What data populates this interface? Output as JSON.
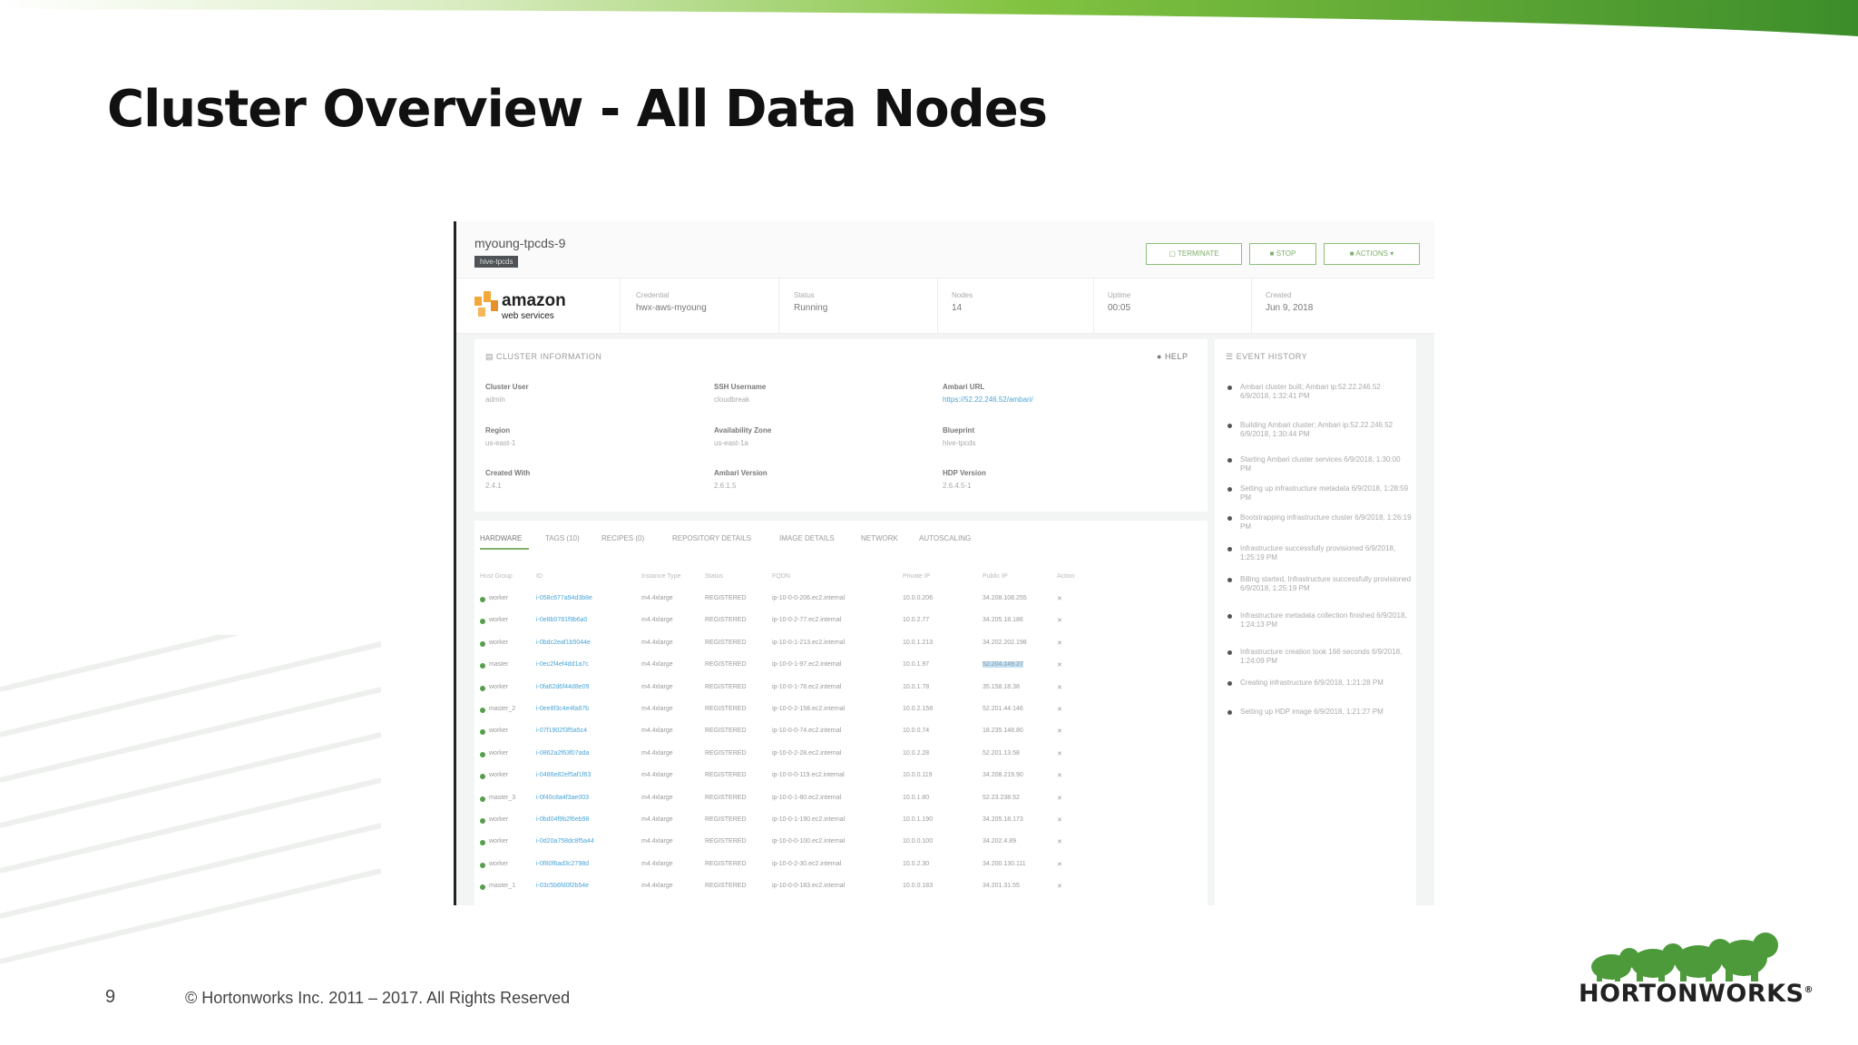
{
  "slide": {
    "title": "Cluster Overview - All Data Nodes",
    "page_number": "9",
    "copyright": "© Hortonworks Inc. 2011 – 2017. All Rights Reserved",
    "logo_text": "HORTONWORKS"
  },
  "colors": {
    "accent_green": "#6fb33f",
    "link_blue": "#4aa5d8"
  },
  "screenshot": {
    "cluster_name": "myoung-tpcds-9",
    "cluster_tag": "hive-tpcds",
    "buttons": {
      "terminate": "TERMINATE",
      "stop": "STOP",
      "actions": "ACTIONS"
    },
    "provider": {
      "line1": "amazon",
      "line2": "web services"
    },
    "summary": [
      {
        "label": "Credential",
        "value": "hwx-aws-myoung"
      },
      {
        "label": "Status",
        "value": "Running"
      },
      {
        "label": "Nodes",
        "value": "14"
      },
      {
        "label": "Uptime",
        "value": "00:05"
      },
      {
        "label": "Created",
        "value": "Jun 9, 2018"
      }
    ],
    "cluster_info": {
      "title": "CLUSTER INFORMATION",
      "help": "HELP",
      "fields": [
        {
          "label": "Cluster User",
          "value": "admin"
        },
        {
          "label": "SSH Username",
          "value": "cloudbreak"
        },
        {
          "label": "Ambari URL",
          "value": "https://52.22.246.52/ambari/"
        },
        {
          "label": "Region",
          "value": "us-east-1"
        },
        {
          "label": "Availability Zone",
          "value": "us-east-1a"
        },
        {
          "label": "Blueprint",
          "value": "hive-tpcds"
        },
        {
          "label": "Created With",
          "value": "2.4.1"
        },
        {
          "label": "Ambari Version",
          "value": "2.6.1.5"
        },
        {
          "label": "HDP Version",
          "value": "2.6.4.5-1"
        }
      ]
    },
    "tabs": [
      "HARDWARE",
      "TAGS (10)",
      "RECIPES (0)",
      "REPOSITORY DETAILS",
      "IMAGE DETAILS",
      "NETWORK",
      "AUTOSCALING"
    ],
    "table": {
      "headers": [
        "Host Group",
        "ID",
        "Instance Type",
        "Status",
        "FQDN",
        "Private IP",
        "Public IP",
        "Action"
      ],
      "rows": [
        [
          "worker",
          "i-058c677a94d3b8e",
          "m4.4xlarge",
          "REGISTERED",
          "ip-10-0-0-206.ec2.internal",
          "10.0.0.206",
          "34.208.108.255",
          "✕"
        ],
        [
          "worker",
          "i-0e8b0781f9b6a0",
          "m4.4xlarge",
          "REGISTERED",
          "ip-10-0-2-77.ec2.internal",
          "10.0.2.77",
          "34.205.18.186",
          "✕"
        ],
        [
          "worker",
          "i-0bdc2eaf1b5044e",
          "m4.4xlarge",
          "REGISTERED",
          "ip-10-0-1-213.ec2.internal",
          "10.0.1.213",
          "34.202.202.198",
          "✕"
        ],
        [
          "master",
          "i-0ec2f4ef4dd1a7c",
          "m4.4xlarge",
          "REGISTERED",
          "ip-10-0-1-97.ec2.internal",
          "10.0.1.97",
          "52.204.149.27",
          "✕"
        ],
        [
          "worker",
          "i-0fa62d6f44d8e09",
          "m4.4xlarge",
          "REGISTERED",
          "ip-10-0-1-78.ec2.internal",
          "10.0.1.78",
          "35.158.18.38",
          "✕"
        ],
        [
          "master_2",
          "i-0ee8f3c4e4fa87b",
          "m4.4xlarge",
          "REGISTERED",
          "ip-10-0-2-158.ec2.internal",
          "10.0.2.158",
          "52.201.44.146",
          "✕"
        ],
        [
          "worker",
          "i-07f1902f3f5a5c4",
          "m4.4xlarge",
          "REGISTERED",
          "ip-10-0-0-74.ec2.internal",
          "10.0.0.74",
          "18.235.148.80",
          "✕"
        ],
        [
          "worker",
          "i-0862a2f63f07ada",
          "m4.4xlarge",
          "REGISTERED",
          "ip-10-0-2-28.ec2.internal",
          "10.0.2.28",
          "52.201.13.58",
          "✕"
        ],
        [
          "worker",
          "i-0486e82ef5af1f63",
          "m4.4xlarge",
          "REGISTERED",
          "ip-10-0-0-119.ec2.internal",
          "10.0.0.119",
          "34.208.219.90",
          "✕"
        ],
        [
          "master_3",
          "i-0f40c8a4f3ae003",
          "m4.4xlarge",
          "REGISTERED",
          "ip-10-0-1-80.ec2.internal",
          "10.0.1.80",
          "52.23.238.52",
          "✕"
        ],
        [
          "worker",
          "i-0bd04f9b2f6eb98",
          "m4.4xlarge",
          "REGISTERED",
          "ip-10-0-1-190.ec2.internal",
          "10.0.1.190",
          "34.205.18.173",
          "✕"
        ],
        [
          "worker",
          "i-0d20a758dc8f5a44",
          "m4.4xlarge",
          "REGISTERED",
          "ip-10-0-0-100.ec2.internal",
          "10.0.0.100",
          "34.202.4.89",
          "✕"
        ],
        [
          "worker",
          "i-0f80f6ad3c2798d",
          "m4.4xlarge",
          "REGISTERED",
          "ip-10-0-2-30.ec2.internal",
          "10.0.2.30",
          "34.200.130.111",
          "✕"
        ],
        [
          "master_1",
          "i-03c5b6fd0f2b54e",
          "m4.4xlarge",
          "REGISTERED",
          "ip-10-0-0-183.ec2.internal",
          "10.0.0.183",
          "34.201.31.55",
          "✕"
        ]
      ]
    },
    "event_history": {
      "title": "EVENT HISTORY",
      "events": [
        "Ambari cluster built; Ambari ip:52.22.246.52 6/9/2018, 1:32:41 PM",
        "Building Ambari cluster; Ambari ip:52.22.246.52 6/9/2018, 1:30:44 PM",
        "Starting Ambari cluster services 6/9/2018, 1:30:00 PM",
        "Setting up infrastructure metadata 6/9/2018, 1:28:59 PM",
        "Bootstrapping infrastructure cluster 6/9/2018, 1:26:19 PM",
        "Infrastructure successfully provisioned 6/9/2018, 1:25:19 PM",
        "Billing started, Infrastructure successfully provisioned 6/9/2018, 1:25:19 PM",
        "Infrastructure metadata collection finished 6/9/2018, 1:24:13 PM",
        "Infrastructure creation took 166 seconds 6/9/2018, 1:24:09 PM",
        "Creating infrastructure 6/9/2018, 1:21:28 PM",
        "Setting up HDP image 6/9/2018, 1:21:27 PM"
      ]
    }
  }
}
